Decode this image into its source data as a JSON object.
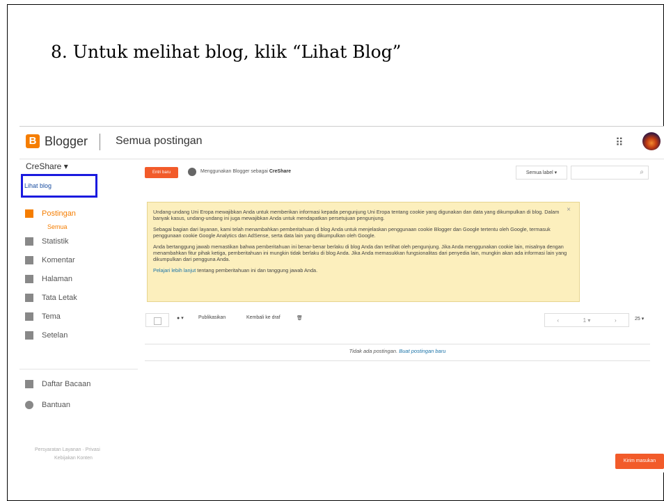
{
  "slide": {
    "title": "8. Untuk melihat blog, klik “Lihat Blog”"
  },
  "header": {
    "logo_letter": "B",
    "brand": "Blogger",
    "page_title": "Semua postingan",
    "apps_glyph": "⠿"
  },
  "sidebar": {
    "blog_name": "CreShare ▾",
    "view_blog": "Lihat blog",
    "items": [
      {
        "label": "Postingan",
        "icon": "posts-icon",
        "active": true
      },
      {
        "label": "Statistik",
        "icon": "stats-icon"
      },
      {
        "label": "Komentar",
        "icon": "comments-icon"
      },
      {
        "label": "Halaman",
        "icon": "pages-icon"
      },
      {
        "label": "Tata Letak",
        "icon": "layout-icon"
      },
      {
        "label": "Tema",
        "icon": "theme-icon"
      },
      {
        "label": "Setelan",
        "icon": "settings-icon"
      },
      {
        "label": "Daftar Bacaan",
        "icon": "reading-list-icon"
      },
      {
        "label": "Bantuan",
        "icon": "help-icon"
      }
    ],
    "sub_item": "Semua",
    "footer_line1": "Persyaratan Layanan   ·   Privasi",
    "footer_line2": "Kebijakan Konten"
  },
  "main": {
    "new_post": "Entri baru",
    "using_text": "Menggunakan Blogger sebagai ",
    "using_name": "CreShare",
    "label_filter": "Semua label ▾",
    "notice": {
      "p1": "Undang-undang Uni Eropa mewajibkan Anda untuk memberikan informasi kepada pengunjung Uni Eropa tentang cookie yang digunakan dan data yang dikumpulkan di blog. Dalam banyak kasus, undang-undang ini juga mewajibkan Anda untuk mendapatkan persetujuan pengunjung.",
      "p2": "Sebagai bagian dari layanan, kami telah menambahkan pemberitahuan di blog Anda untuk menjelaskan penggunaan cookie Blogger dan Google tertentu oleh Google, termasuk penggunaan cookie Google Analytics dan AdSense, serta data lain yang dikumpulkan oleh Google.",
      "p3": "Anda bertanggung jawab memastikan bahwa pemberitahuan ini benar-benar berlaku di blog Anda dan terlihat oleh pengunjung. Jika Anda menggunakan cookie lain, misalnya dengan menambahkan fitur pihak ketiga, pemberitahuan ini mungkin tidak berlaku di blog Anda. Jika Anda memasukkan fungsionalitas dari penyedia lain, mungkin akan ada informasi lain yang dikumpulkan dari pengguna Anda.",
      "link": "Pelajari lebih lanjut",
      "p4_rest": " tentang pemberitahuan ini dan tanggung jawab Anda.",
      "close": "×"
    },
    "toolbar": {
      "label_glyph": "▾",
      "publish": "Publikasikan",
      "revert": "Kembali ke draf",
      "delete_glyph": "🗑",
      "pager_prev": "‹",
      "pager_page": "1 ▾",
      "pager_next": "›",
      "per_page": "25 ▾"
    },
    "empty_text": "Tidak ada postingan. ",
    "empty_link": "Buat postingan baru"
  },
  "feedback": "Kirim masukan"
}
